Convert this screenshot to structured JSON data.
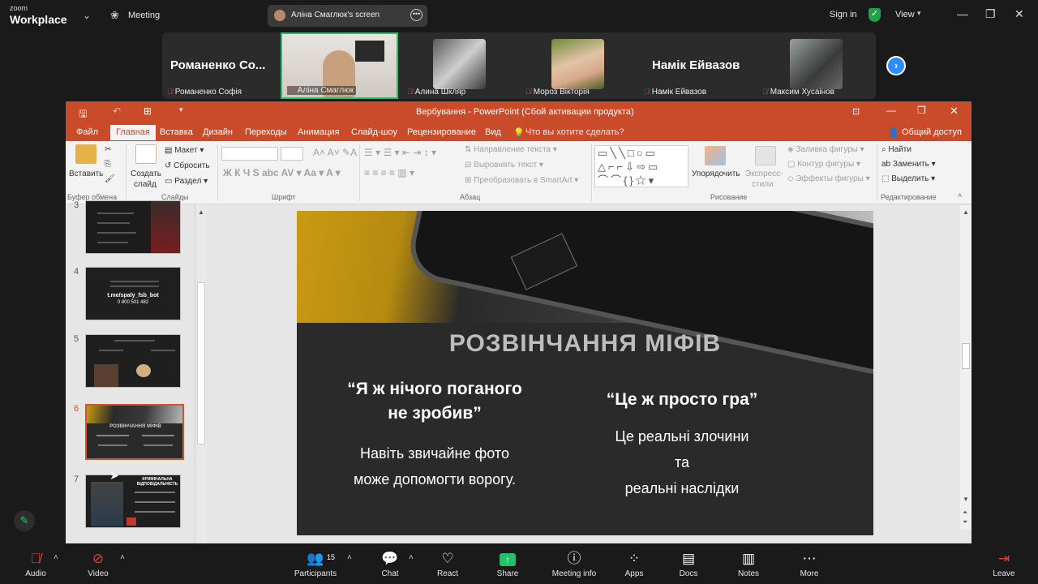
{
  "zoom": {
    "brand_small": "zoom",
    "brand": "Workplace",
    "meeting_label": "Meeting",
    "screen_share_label": "Аліна Смаглюк's screen",
    "sign_in": "Sign in",
    "view": "View"
  },
  "participants": [
    {
      "big_name": "Романенко Со...",
      "name": "Романенко Софія"
    },
    {
      "name": "Аліна Смаглюк"
    },
    {
      "name": "Алина Шкляр"
    },
    {
      "name": "Мороз Вікторія"
    },
    {
      "big_name": "Намік Ейвазов",
      "name": "Намік Ейвазов"
    },
    {
      "name": "Максим Хусаінов"
    }
  ],
  "ppt": {
    "window_title": "Вербування - PowerPoint (Сбой активации продукта)",
    "tabs": [
      "Файл",
      "Главная",
      "Вставка",
      "Дизайн",
      "Переходы",
      "Анимация",
      "Слайд-шоу",
      "Рецензирование",
      "Вид"
    ],
    "tell_me": "Что вы хотите сделать?",
    "share": "Общий доступ",
    "ribbon": {
      "paste": "Вставить",
      "clipboard_group": "Буфер обмена",
      "new_slide_1": "Создать",
      "new_slide_2": "слайд",
      "layout": "Макет",
      "reset": "Сбросить",
      "section": "Раздел",
      "slides_group": "Слайды",
      "font_group": "Шрифт",
      "text_direction": "Направление текста",
      "align_text": "Выровнять текст",
      "smartart": "Преобразовать в SmartArt",
      "paragraph_group": "Абзац",
      "arrange": "Упорядочить",
      "quick_styles_1": "Экспресс-",
      "quick_styles_2": "стили",
      "shape_fill": "Заливка фигуры",
      "shape_outline": "Контур фигуры",
      "shape_effects": "Эффекты фигуры",
      "drawing_group": "Рисование",
      "find": "Найти",
      "replace": "Заменить",
      "select": "Выделить",
      "editing_group": "Редактирование"
    },
    "thumb_numbers": [
      "3",
      "4",
      "5",
      "6",
      "7"
    ],
    "thumb4_link": "t.me/spaly_fsb_bot",
    "thumb4_phone": "0 800 501 482",
    "thumb6_title": "РОЗВІНЧАННЯ МІФІВ",
    "thumb7_title": "КРИМІНАЛЬНА ВІДПОВІДАЛЬНІСТЬ",
    "slide": {
      "title": "РОЗВІНЧАННЯ МІФІВ",
      "left_heading_1": "“Я ж нічого поганого",
      "left_heading_2": "не зробив”",
      "left_body_1": "Навіть звичайне фото",
      "left_body_2": "може допомогти ворогу.",
      "right_heading": "“Це ж просто гра”",
      "right_body_1": "Це реальні злочини",
      "right_body_2": "та",
      "right_body_3": "реальні наслідки"
    }
  },
  "toolbar": {
    "audio": "Audio",
    "video": "Video",
    "participants": "Participants",
    "participants_count": "15",
    "chat": "Chat",
    "react": "React",
    "share": "Share",
    "meeting_info": "Meeting info",
    "apps": "Apps",
    "docs": "Docs",
    "notes": "Notes",
    "more": "More",
    "leave": "Leave"
  },
  "colors": {
    "ppt_accent": "#c94b2a",
    "zoom_green": "#1ea446",
    "zoom_blue": "#2d8cff",
    "share_green": "#22c06a",
    "muted_red": "#e0413b"
  }
}
